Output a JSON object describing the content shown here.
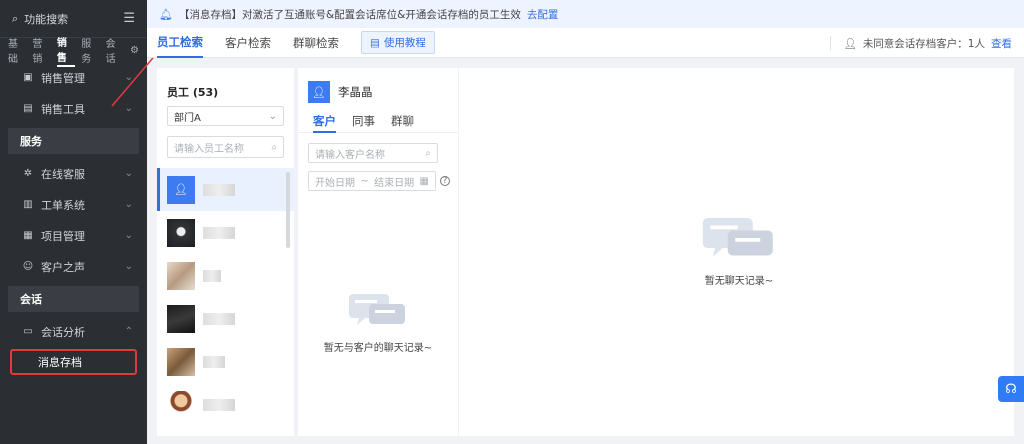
{
  "sidebar": {
    "search_label": "功能搜索",
    "tabs": [
      "基础",
      "营销",
      "销售",
      "服务",
      "会话"
    ],
    "active_tab": "销售",
    "items": [
      {
        "label": "销售管理"
      },
      {
        "label": "销售工具"
      }
    ],
    "group_service": "服务",
    "service_items": [
      {
        "label": "在线客服"
      },
      {
        "label": "工单系统"
      },
      {
        "label": "项目管理"
      },
      {
        "label": "客户之声"
      }
    ],
    "group_chat": "会话",
    "chat_items": [
      {
        "label": "会话分析"
      }
    ],
    "sub_active": "消息存档"
  },
  "notice": {
    "text": "【消息存档】对激活了互通账号&配置会话席位&开通会话存档的员工生效",
    "link": "去配置"
  },
  "tabs": [
    "员工检索",
    "客户检索",
    "群聊检索"
  ],
  "active_tab": "员工检索",
  "tutorial": "使用教程",
  "consent": {
    "text": "未同意会话存档客户：1人",
    "link": "查看"
  },
  "employee": {
    "title": "员工 (53)",
    "department": "部门A",
    "search_placeholder": "请输入员工名称"
  },
  "customer": {
    "name": "李晶晶",
    "tabs": [
      "客户",
      "同事",
      "群聊"
    ],
    "active_tab": "客户",
    "search_placeholder": "请输入客户名称",
    "start_date": "开始日期",
    "end_date": "结束日期",
    "empty": "暂无与客户的聊天记录~"
  },
  "chat": {
    "empty": "暂无聊天记录~"
  },
  "colors": {
    "accent": "#2f6fe0",
    "sidebar_bg": "#2b2e33",
    "highlight_border": "#e0393e"
  }
}
